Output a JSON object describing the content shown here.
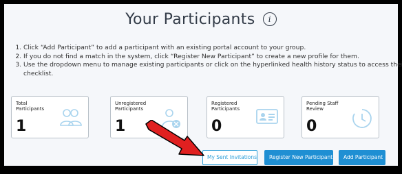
{
  "page": {
    "title": "Your Participants",
    "info_glyph": "i"
  },
  "instructions": [
    "Click “Add Participant” to add a participant with an existing portal account to your group.",
    "If you do not find a match in the system, click “Register New Participant” to create a new profile for them.",
    "Use the dropdown menu to manage existing participants or click on the hyperlinked health history status to access their checklist."
  ],
  "cards": [
    {
      "label": "Total Participants",
      "count": "1",
      "icon": "people-icon"
    },
    {
      "label": "Unregistered Participants",
      "count": "1",
      "icon": "user-remove-icon"
    },
    {
      "label": "Registered Participants",
      "count": "0",
      "icon": "id-card-icon"
    },
    {
      "label": "Pending Staff Review",
      "count": "0",
      "icon": "clock-icon"
    }
  ],
  "buttons": {
    "sent_invitations": "My Sent Invitations",
    "register_new": "Register New Participant",
    "add_participant": "Add Participant"
  },
  "colors": {
    "accent": "#1f8fd3",
    "icon_light": "#a9d4ee",
    "arrow": "#e02020"
  }
}
